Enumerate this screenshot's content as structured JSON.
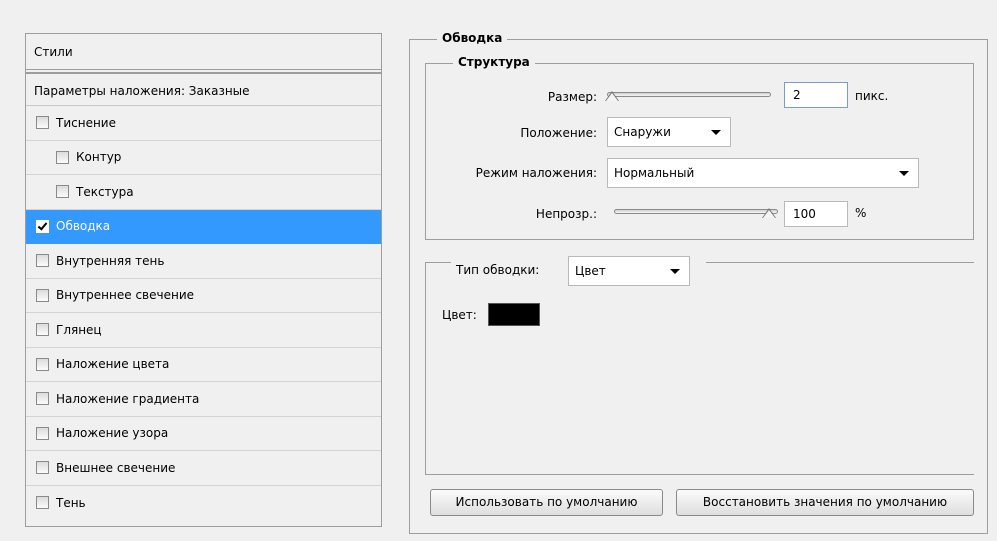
{
  "left_panel": {
    "header": "Стили",
    "blending_options": "Параметры наложения: Заказные",
    "items": [
      {
        "label": "Тиснение",
        "checked": false
      },
      {
        "label": "Контур",
        "checked": false
      },
      {
        "label": "Текстура",
        "checked": false
      },
      {
        "label": "Обводка",
        "checked": true
      },
      {
        "label": "Внутренняя тень",
        "checked": false
      },
      {
        "label": "Внутреннее свечение",
        "checked": false
      },
      {
        "label": "Глянец",
        "checked": false
      },
      {
        "label": "Наложение цвета",
        "checked": false
      },
      {
        "label": "Наложение градиента",
        "checked": false
      },
      {
        "label": "Наложение узора",
        "checked": false
      },
      {
        "label": "Внешнее свечение",
        "checked": false
      },
      {
        "label": "Тень",
        "checked": false
      }
    ]
  },
  "stroke": {
    "title": "Обводка",
    "structure": {
      "title": "Структура",
      "size_label": "Размер:",
      "size_value": "2",
      "size_unit": "пикс.",
      "position_label": "Положение:",
      "position_value": "Снаружи",
      "blend_mode_label": "Режим наложения:",
      "blend_mode_value": "Нормальный",
      "opacity_label": "Непрозр.:",
      "opacity_value": "100",
      "opacity_unit": "%"
    },
    "fill_type": {
      "label": "Тип обводки:",
      "value": "Цвет",
      "color_label": "Цвет:",
      "color": "#000000"
    },
    "buttons": {
      "make_default": "Использовать по умолчанию",
      "reset_default": "Восстановить значения по умолчанию"
    }
  }
}
